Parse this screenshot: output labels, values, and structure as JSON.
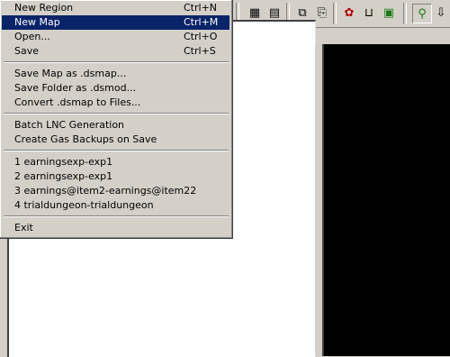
{
  "menu": {
    "items": [
      {
        "label": "New Region",
        "shortcut": "Ctrl+N"
      },
      {
        "label": "New Map",
        "shortcut": "Ctrl+M",
        "highlighted": true
      },
      {
        "label": "Open...",
        "shortcut": "Ctrl+O"
      },
      {
        "label": "Save",
        "shortcut": "Ctrl+S"
      },
      {
        "label": "Save Map as .dsmap..."
      },
      {
        "label": "Save Folder as .dsmod..."
      },
      {
        "label": "Convert .dsmap to Files..."
      },
      {
        "label": "Batch LNC Generation"
      },
      {
        "label": "Create Gas Backups on Save"
      },
      {
        "label": "1 earningsexp-exp1"
      },
      {
        "label": "2 earningsexp-exp1"
      },
      {
        "label": "3 earnings@item2-earnings@item22"
      },
      {
        "label": "4 trialdungeon-trialdungeon"
      },
      {
        "label": "Exit"
      }
    ]
  },
  "toolbar": {
    "icons": [
      "grid-icon",
      "grid-alt-icon",
      "copy-icon",
      "paste-icon",
      "settings-icon",
      "bucket-icon",
      "map-icon",
      "link-icon",
      "arrow-down-icon"
    ]
  },
  "colors": {
    "menu_bg": "#d4d0c8",
    "highlight": "#0a246a",
    "panel_white": "#ffffff",
    "panel_black": "#000000"
  }
}
